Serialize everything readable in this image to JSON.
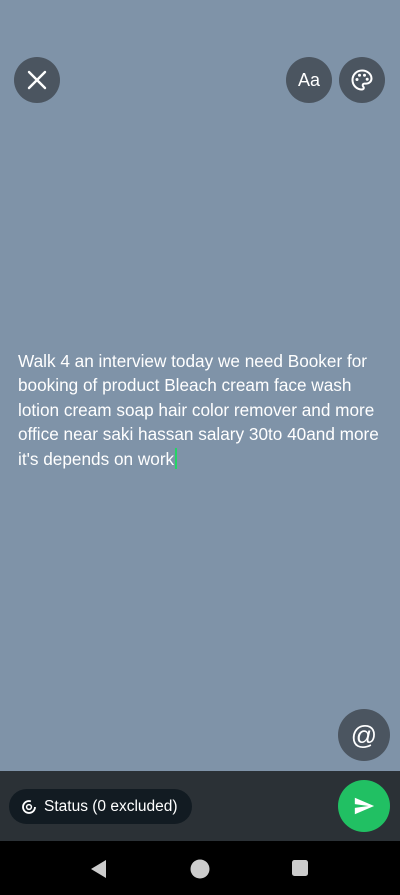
{
  "editor": {
    "text": "Walk 4 an interview today we need Booker for booking of product Bleach cream  face wash lotion cream soap hair color remover and more  office near saki hassan  salary 30to 40and more  it's depends on work"
  },
  "toolbar": {
    "close_icon": "close-icon",
    "font_label": "Aa",
    "palette_icon": "palette-icon"
  },
  "mention": {
    "label": "@"
  },
  "status": {
    "label": "Status (0 excluded)"
  },
  "colors": {
    "background": "#7f93a8",
    "caret": "#25d366",
    "send": "#21c063"
  },
  "nav": {
    "back_icon": "back-triangle-icon",
    "home_icon": "home-circle-icon",
    "recent_icon": "recent-square-icon"
  }
}
